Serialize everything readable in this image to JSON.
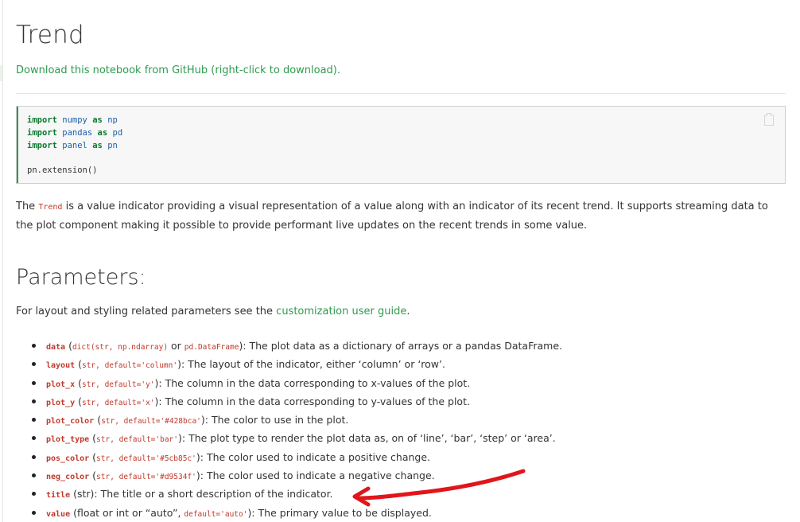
{
  "page": {
    "title": "Trend",
    "download_link": "Download this notebook from GitHub (right-click to download)."
  },
  "code_cell": {
    "lines": [
      [
        "import",
        "numpy",
        "as",
        "np"
      ],
      [
        "import",
        "pandas",
        "as",
        "pd"
      ],
      [
        "import",
        "panel",
        "as",
        "pn"
      ]
    ],
    "extension_line": "pn.extension()",
    "copy_icon": "copy-icon"
  },
  "intro": {
    "prefix": "The",
    "code": "Trend",
    "text": "is a value indicator providing a visual representation of a value along with an indicator of its recent trend. It supports streaming data to the plot component making it possible to provide performant live updates on the recent trends in some value."
  },
  "parameters": {
    "heading": "Parameters:",
    "layout_text_before": "For layout and styling related parameters see the",
    "layout_link": "customization user guide",
    "layout_text_after": ".",
    "items": [
      {
        "name": "data",
        "open": " (",
        "type": "dict(str, np.ndarray)",
        "mid": " or ",
        "type2": "pd.DataFrame",
        "close": "): ",
        "desc": "The plot data as a dictionary of arrays or a pandas DataFrame."
      },
      {
        "name": "layout",
        "open": " (",
        "type": "str, default='column'",
        "close": "): ",
        "desc": "The layout of the indicator, either ‘column’ or ‘row’."
      },
      {
        "name": "plot_x",
        "open": " (",
        "type": "str, default='y'",
        "close": "): ",
        "desc": "The column in the data corresponding to x-values of the plot."
      },
      {
        "name": "plot_y",
        "open": " (",
        "type": "str, default='x'",
        "close": "): ",
        "desc": "The column in the data corresponding to y-values of the plot."
      },
      {
        "name": "plot_color",
        "open": " (",
        "type": "str, default='#428bca'",
        "close": "): ",
        "desc": "The color to use in the plot."
      },
      {
        "name": "plot_type",
        "open": " (",
        "type": "str, default='bar'",
        "close": "): ",
        "desc": "The plot type to render the plot data as, on of ‘line’, ‘bar’, ‘step’ or ‘area’."
      },
      {
        "name": "pos_color",
        "open": " (",
        "type": "str, default='#5cb85c'",
        "close": "): ",
        "desc": "The color used to indicate a positive change."
      },
      {
        "name": "neg_color",
        "open": " (",
        "type": "str, default='#d9534f'",
        "close": "): ",
        "desc": "The color used to indicate a negative change."
      },
      {
        "name": "title",
        "open": " (str): ",
        "desc": "The title or a short description of the indicator."
      },
      {
        "name": "value",
        "open": " (float or int or “auto”, ",
        "type": "default='auto'",
        "close": "): ",
        "desc": "The primary value to be displayed."
      }
    ]
  },
  "colors": {
    "link": "#2e9b4e",
    "code_accent": "#c0392b",
    "annotation_arrow": "#e0161b"
  }
}
